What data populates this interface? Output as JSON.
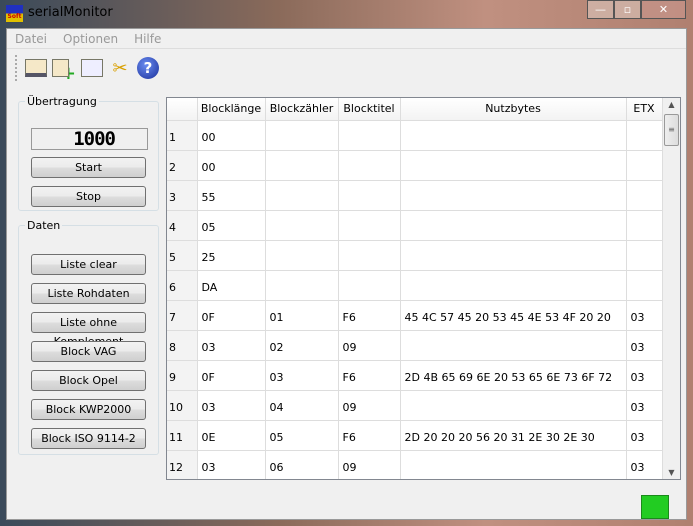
{
  "window": {
    "title": "serialMonitor",
    "minimize": "—",
    "maximize": "▫",
    "close": "✕"
  },
  "menu": [
    "Datei",
    "Optionen",
    "Hilfe"
  ],
  "toolbar": [
    "table-save-icon",
    "table-add-icon",
    "report-icon",
    "tools-icon",
    "help-icon"
  ],
  "help_glyph": "?",
  "uebertragung": {
    "label": "Übertragung",
    "counter": "1000",
    "start": "Start",
    "stop": "Stop"
  },
  "daten": {
    "label": "Daten",
    "buttons": [
      "Liste clear",
      "Liste Rohdaten",
      "Liste ohne Komplement",
      "Block VAG",
      "Block Opel",
      "Block KWP2000",
      "Block ISO  9114-2"
    ]
  },
  "table": {
    "columns": [
      "",
      "Blocklänge",
      "Blockzähler",
      "Blocktitel",
      "Nutzbytes",
      "ETX"
    ],
    "rows": [
      [
        "1",
        "00",
        "",
        "",
        "",
        ""
      ],
      [
        "2",
        "00",
        "",
        "",
        "",
        ""
      ],
      [
        "3",
        "55",
        "",
        "",
        "",
        ""
      ],
      [
        "4",
        "05",
        "",
        "",
        "",
        ""
      ],
      [
        "5",
        "25",
        "",
        "",
        "",
        ""
      ],
      [
        "6",
        "DA",
        "",
        "",
        "",
        ""
      ],
      [
        "7",
        "0F",
        "01",
        "F6",
        "45  4C  57  45  20  53  45  4E  53  4F  20  20",
        "03"
      ],
      [
        "8",
        "03",
        "02",
        "09",
        "",
        "03"
      ],
      [
        "9",
        "0F",
        "03",
        "F6",
        "2D  4B  65  69  6E  20  53  65  6E  73  6F  72",
        "03"
      ],
      [
        "10",
        "03",
        "04",
        "09",
        "",
        "03"
      ],
      [
        "11",
        "0E",
        "05",
        "F6",
        "2D  20  20  20  56  20  31  2E  30  2E  30",
        "03"
      ],
      [
        "12",
        "03",
        "06",
        "09",
        "",
        "03"
      ]
    ]
  },
  "status": {
    "led_color": "#22cc22"
  }
}
